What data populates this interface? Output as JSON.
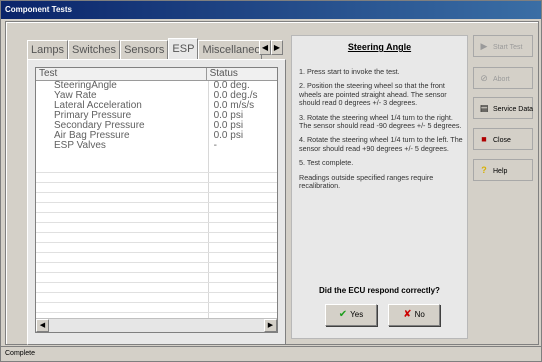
{
  "window": {
    "title": "Component Tests"
  },
  "tabs": [
    {
      "label": "Lamps",
      "active": false
    },
    {
      "label": "Switches",
      "active": false
    },
    {
      "label": "Sensors",
      "active": false
    },
    {
      "label": "ESP",
      "active": true
    },
    {
      "label": "Miscellaneous",
      "active": false
    }
  ],
  "tab_scroll": {
    "left": "◀",
    "right": "▶"
  },
  "list": {
    "columns": [
      "Test",
      "Status"
    ],
    "rows": [
      {
        "test": "SteeringAngle",
        "status": "0.0 deg."
      },
      {
        "test": "Yaw Rate",
        "status": "0.0 deg./s"
      },
      {
        "test": "Lateral Acceleration",
        "status": "0.0 m/s/s"
      },
      {
        "test": "Primary Pressure",
        "status": "0.0 psi"
      },
      {
        "test": "Secondary Pressure",
        "status": "0.0 psi"
      },
      {
        "test": "Air Bag Pressure",
        "status": "0.0 psi"
      },
      {
        "test": "ESP Valves",
        "status": "-"
      }
    ],
    "scroll_left": "◀",
    "scroll_right": "▶"
  },
  "instructions": {
    "title": "Steering Angle",
    "steps": [
      "1. Press start to invoke the test.",
      "2. Position the steering wheel so that the front wheels are pointed straight ahead. The sensor should read 0 degrees +/- 3 degrees.",
      "3. Rotate the steering wheel 1/4 turn to the right. The sensor should read -90 degrees +/- 5 degrees.",
      "4. Rotate the steering wheel 1/4 turn to the left. The sensor should read +90 degrees +/- 5 degrees.",
      "5. Test complete.",
      "Readings outside specified ranges require recalibration."
    ],
    "question": "Did the ECU respond correctly?",
    "yes_label": "Yes",
    "no_label": "No",
    "yes_icon": "✔",
    "no_icon": "✘"
  },
  "side_buttons": [
    {
      "label": "Start Test",
      "icon": "play-icon",
      "glyph": "▶",
      "enabled": false
    },
    {
      "label": "Abort",
      "icon": "stop-icon",
      "glyph": "⊘",
      "enabled": false
    },
    {
      "label": "Service Data",
      "icon": "service-data-icon",
      "glyph": "▤",
      "enabled": true
    },
    {
      "label": "Close",
      "icon": "close-door-icon",
      "glyph": "■",
      "enabled": true
    },
    {
      "label": "Help",
      "icon": "help-icon",
      "glyph": "?",
      "enabled": true
    }
  ],
  "status_bar": {
    "text": "Complete"
  },
  "colors": {
    "title_bar": "#0a246a",
    "yes_icon": "#1e9e1e",
    "no_icon": "#cc0000",
    "help_icon": "#d8b000",
    "close_icon": "#b00000"
  }
}
